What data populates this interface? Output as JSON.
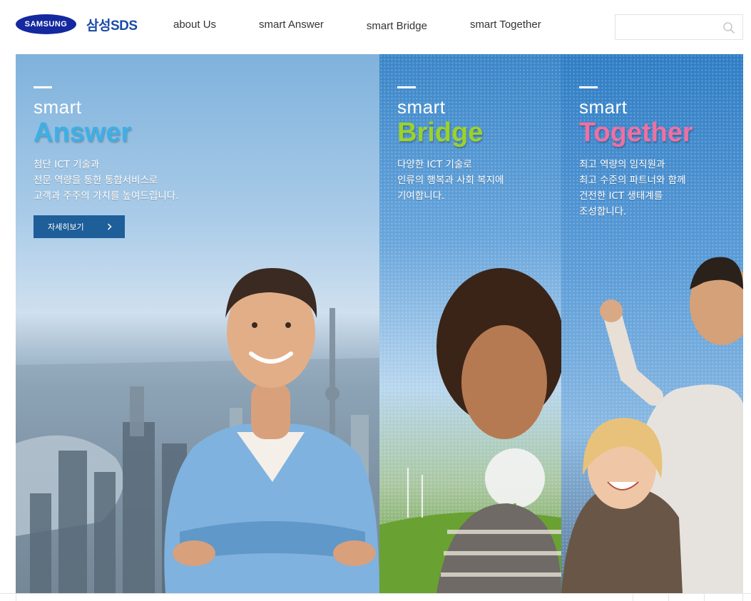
{
  "header": {
    "logo": {
      "brand": "SAMSUNG",
      "division": "삼성SDS"
    },
    "nav": [
      "about Us",
      "smart Answer",
      "smart Bridge",
      "smart Together"
    ],
    "search": {
      "placeholder": "",
      "icon": "search-icon"
    }
  },
  "panels": {
    "answer": {
      "kicker": "smart",
      "title": "Answer",
      "title_color": "#3cb0e6",
      "description": "첨단 ICT 기술과\n전문 역량을 통한 통합서비스로\n고객과 주주의 가치를 높여드립니다.",
      "button_label": "자세히보기",
      "button_icon": "chevron-right-icon"
    },
    "bridge": {
      "kicker": "smart",
      "title": "Bridge",
      "title_color": "#9cd22a",
      "description": "다양한 ICT 기술로\n인류의 행복과 사회 복지에\n기여합니다."
    },
    "together": {
      "kicker": "smart",
      "title": "Together",
      "title_color": "#f06fa3",
      "description": "최고 역량의 임직원과\n최고 수준의 파트너와 함께\n건전한 ICT 생태계를\n조성합니다."
    }
  },
  "colors": {
    "button_bg": "#1e5e99",
    "logo_blue": "#1428a0"
  }
}
